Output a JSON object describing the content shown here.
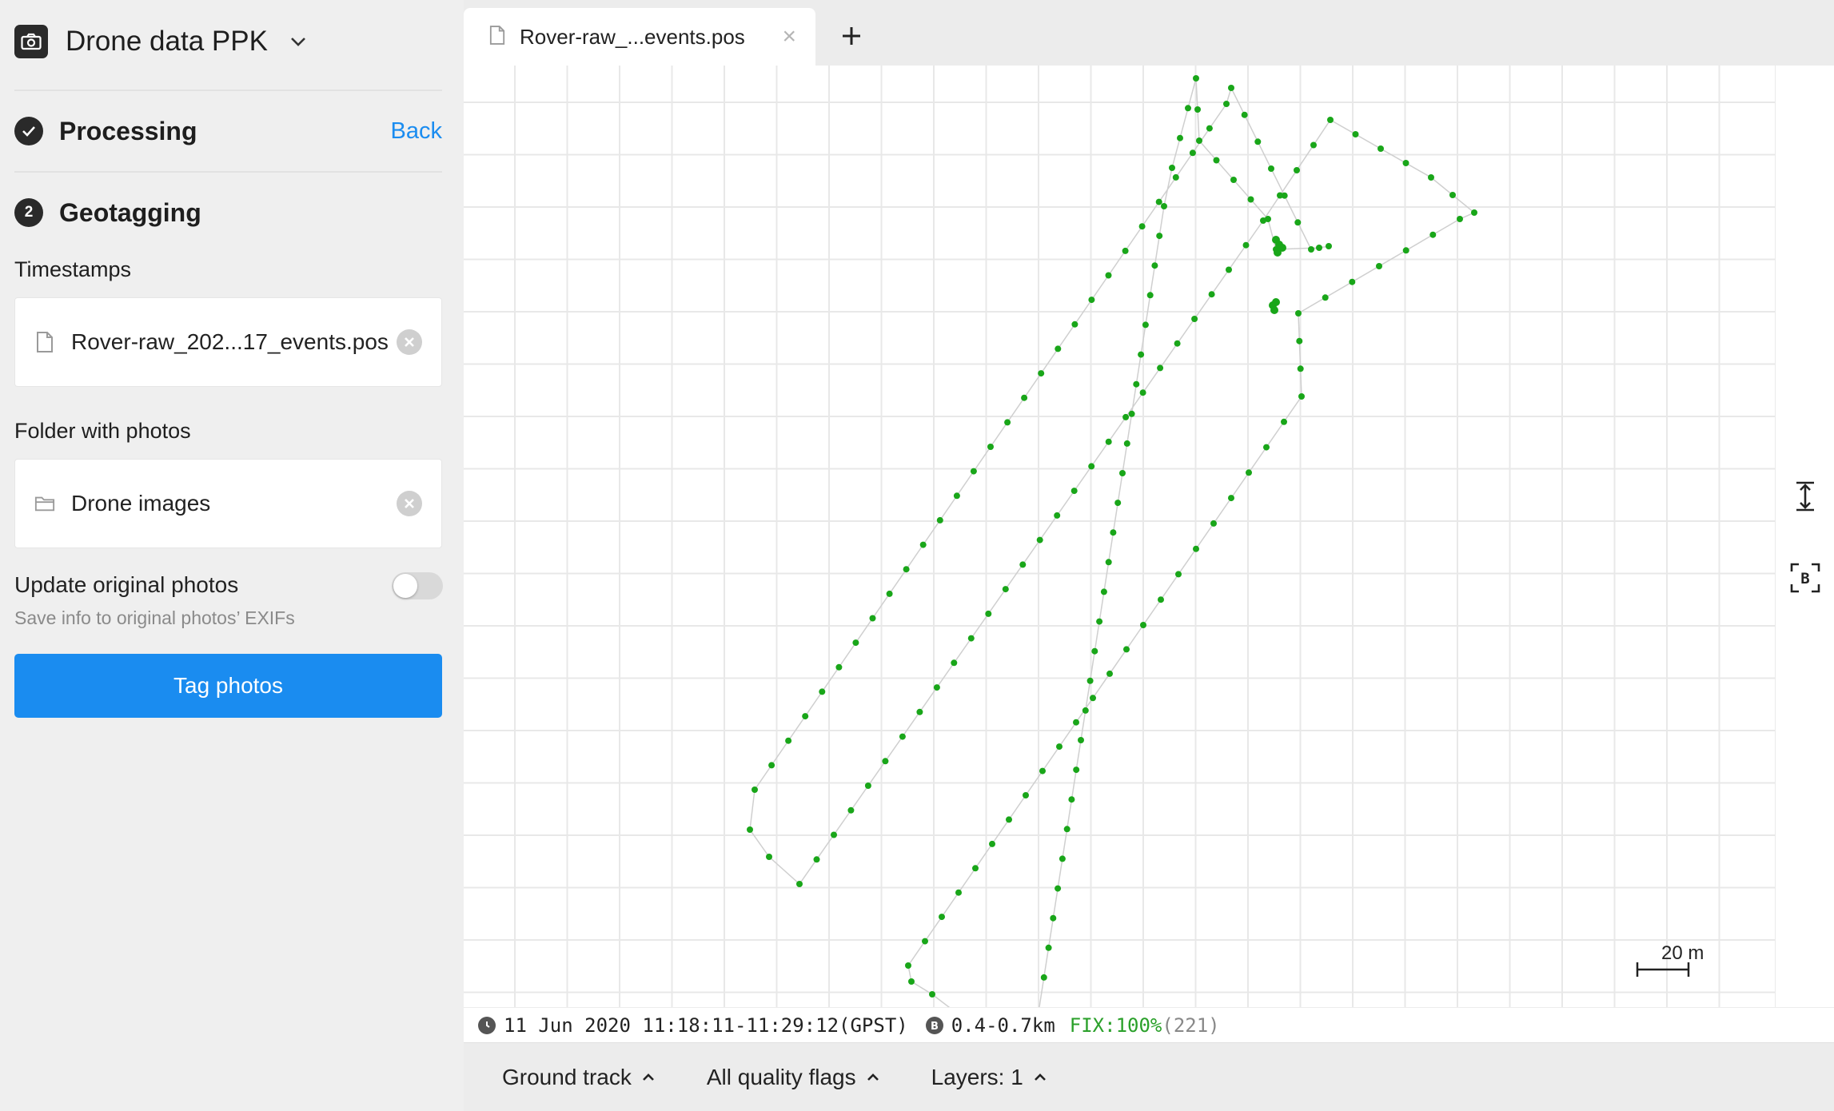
{
  "sidebar": {
    "project_title": "Drone data PPK",
    "step_processing": {
      "title": "Processing",
      "back_label": "Back"
    },
    "step_geotagging": {
      "number": "2",
      "title": "Geotagging"
    },
    "timestamps": {
      "label": "Timestamps",
      "file_name": "Rover-raw_202...17_events.pos"
    },
    "photos": {
      "label": "Folder with photos",
      "folder_name": "Drone images"
    },
    "update_toggle": {
      "label": "Update original photos",
      "sublabel": "Save info to original photos’ EXIFs",
      "enabled": false
    },
    "tag_button_label": "Tag photos"
  },
  "tabs": [
    {
      "label": "Rover-raw_...events.pos",
      "icon": "file-icon"
    }
  ],
  "map": {
    "scale_label": "20 m",
    "track_color": "#19a619"
  },
  "status": {
    "time_range": "11 Jun 2020 11:18:11-11:29:12(GPST)",
    "baseline": "0.4-0.7km",
    "fix": "FIX:100%",
    "fix_count": "(221)"
  },
  "bottombar": {
    "ground_track": "Ground track",
    "quality_flags": "All quality flags",
    "layers": "Layers: 1"
  },
  "colors": {
    "accent": "#1a8cf0",
    "fix_green": "#2aa02a"
  }
}
